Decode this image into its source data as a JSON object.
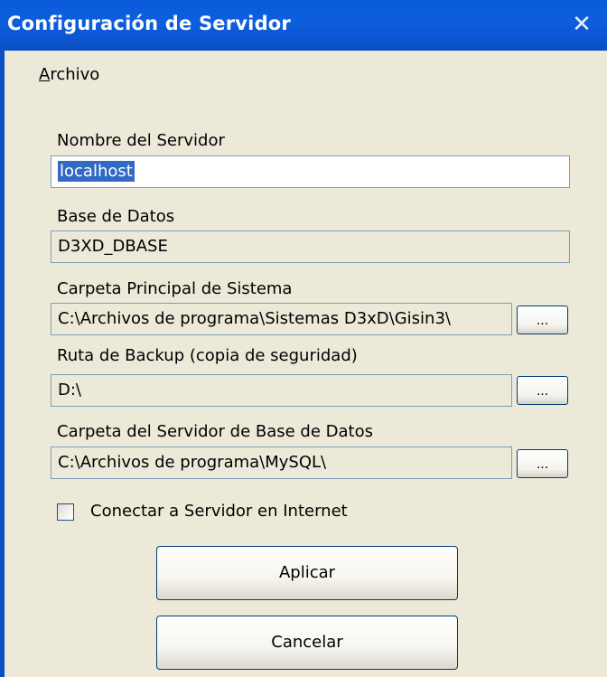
{
  "window": {
    "title": "Configuración de Servidor",
    "close_glyph": "✕"
  },
  "menu": {
    "archivo_first": "A",
    "archivo_rest": "rchivo"
  },
  "fields": {
    "server_name": {
      "label": "Nombre del Servidor",
      "value": "localhost"
    },
    "database": {
      "label": "Base de Datos",
      "value": "D3XD_DBASE"
    },
    "main_folder": {
      "label": "Carpeta Principal de Sistema",
      "value": "C:\\Archivos de programa\\Sistemas D3xD\\Gisin3\\"
    },
    "backup_path": {
      "label": "Ruta de Backup  (copia de seguridad)",
      "value": "D:\\"
    },
    "db_server_folder": {
      "label": "Carpeta del Servidor de Base de Datos",
      "value": "C:\\Archivos de programa\\MySQL\\"
    }
  },
  "browse_label": "...",
  "internet_checkbox": {
    "label": "Conectar a Servidor en Internet",
    "checked": false
  },
  "buttons": {
    "apply": "Aplicar",
    "cancel": "Cancelar"
  }
}
